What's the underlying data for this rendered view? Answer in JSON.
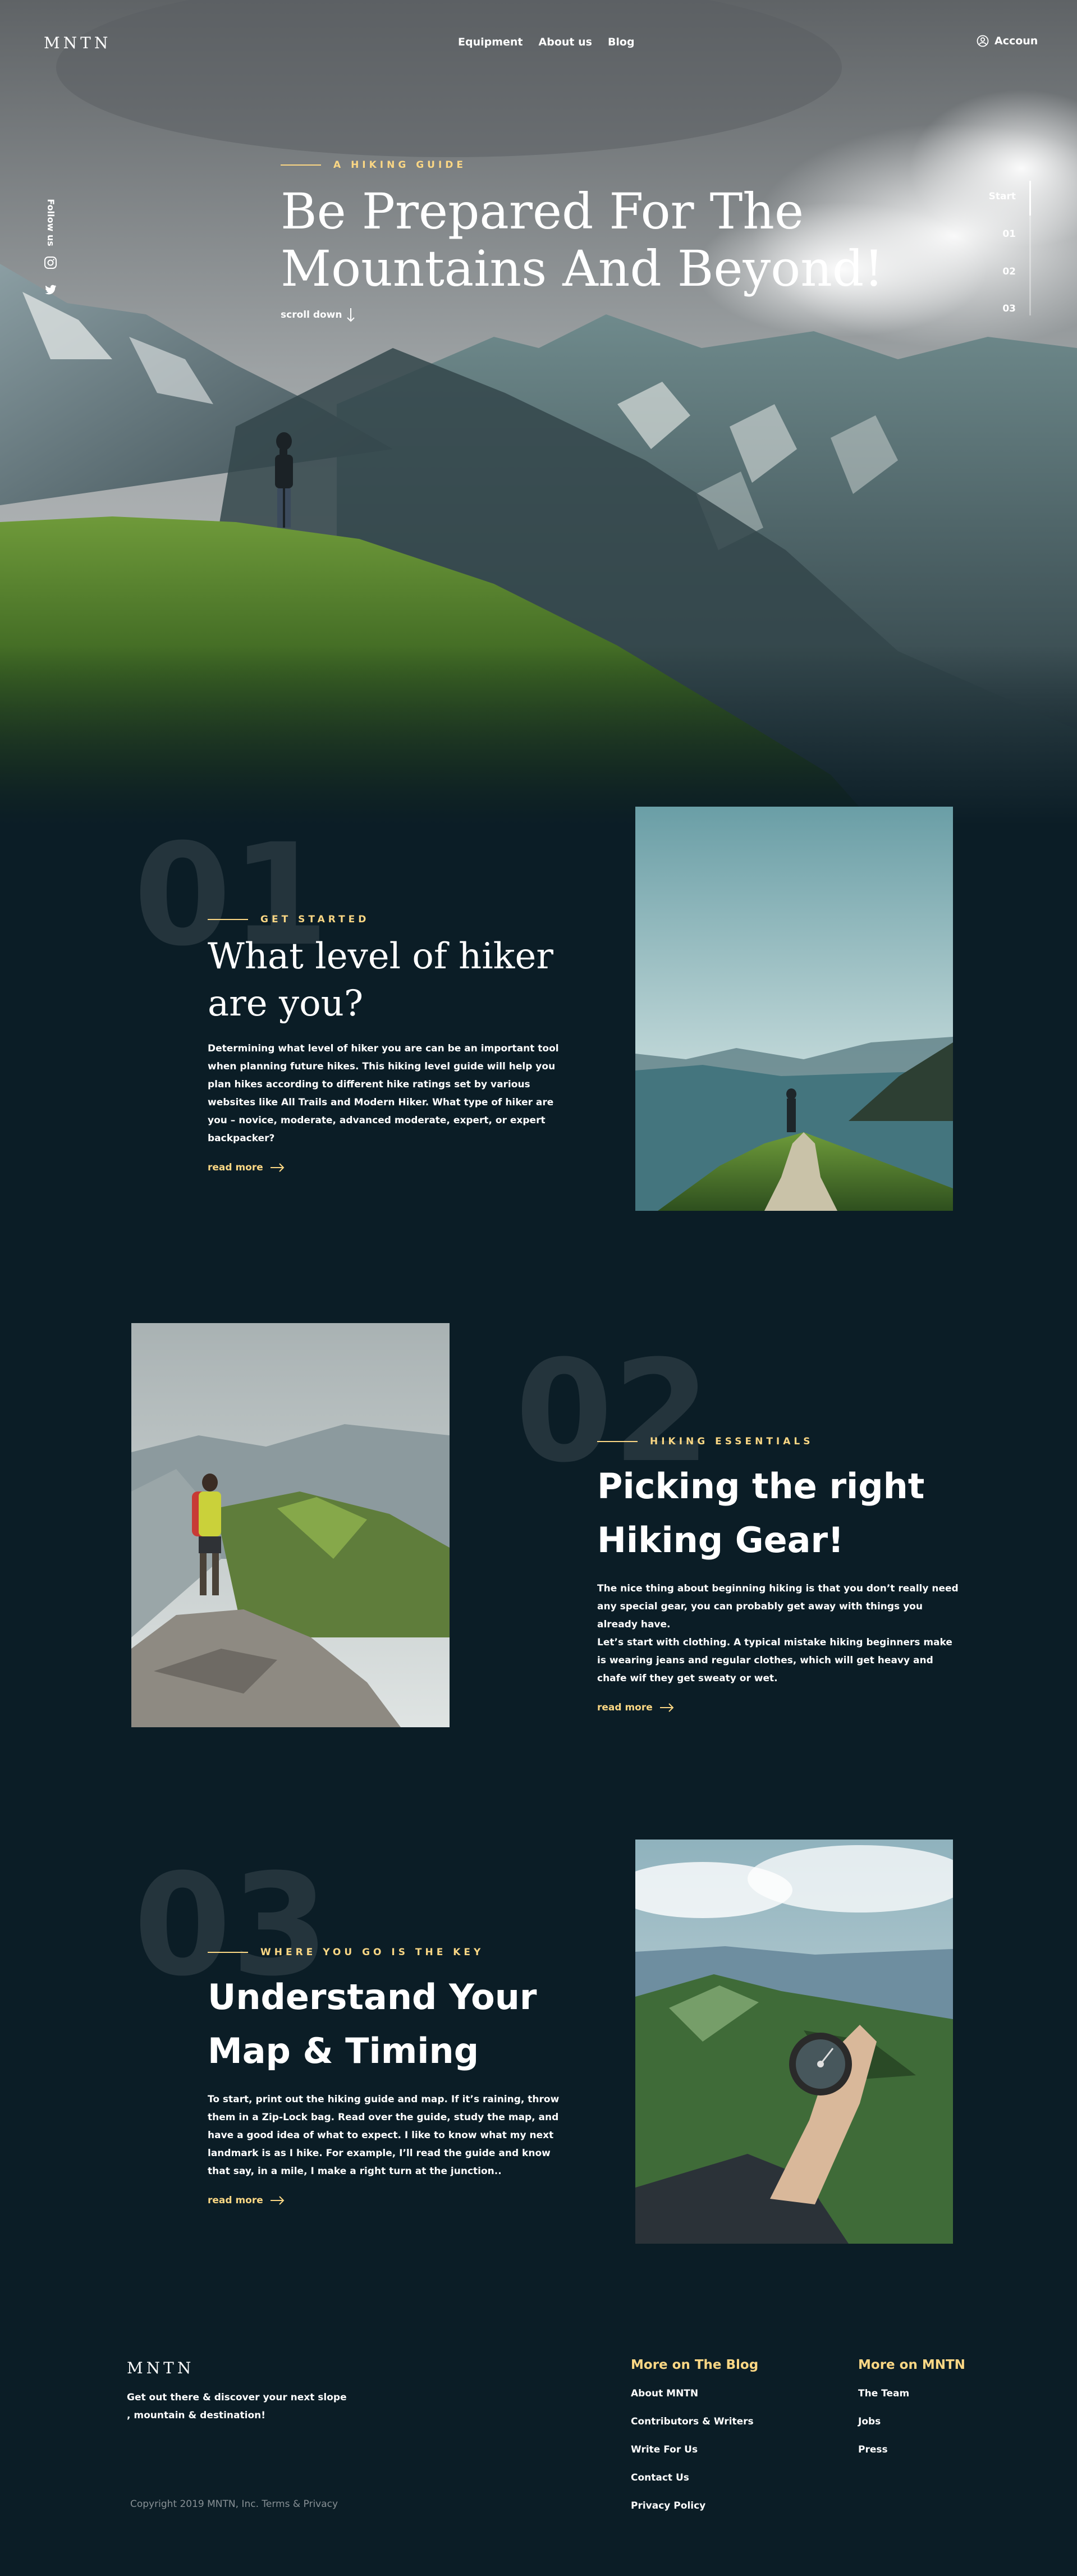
{
  "header": {
    "logo": "MNTN",
    "nav": [
      "Equipment",
      "About us",
      "Blog"
    ],
    "account": "Accoun"
  },
  "social": {
    "label": "Follow us",
    "icons": [
      "instagram-icon",
      "twitter-icon"
    ]
  },
  "hero": {
    "eyebrow": "A HIKING GUIDE",
    "title_line1": "Be Prepared For The",
    "title_line2": "Mountains And Beyond!",
    "scroll": "scroll down"
  },
  "progress": {
    "items": [
      "Start",
      "01",
      "02",
      "03"
    ],
    "active": "Start"
  },
  "sections": [
    {
      "number": "01",
      "eyebrow": "GET STARTED",
      "title_line1": "What level of  hiker",
      "title_line2": "are you?",
      "body": "Determining what level of hiker you are can be an important tool when planning future hikes. This hiking level guide will help you plan hikes according to different hike ratings set by various websites like All Trails and Modern Hiker. What type of hiker are you – novice, moderate, advanced moderate, expert, or expert backpacker?",
      "link": "read more"
    },
    {
      "number": "02",
      "eyebrow": "HIKING ESSENTIALS",
      "title_line1": "Picking the right",
      "title_line2": "Hiking Gear!",
      "body": "The nice thing about beginning hiking is that you don’t really need any special gear, you can probably get away with things you already have.",
      "body2": "Let’s start with clothing. A typical mistake hiking beginners make is wearing jeans and regular clothes, which will get heavy and chafe wif they get sweaty or wet.",
      "link": "read more"
    },
    {
      "number": "03",
      "eyebrow": "WHERE YOU GO IS THE KEY",
      "title_line1": "Understand Your",
      "title_line2": "Map & Timing",
      "body": "To start, print out the hiking guide and map. If it’s raining, throw them in a Zip-Lock bag. Read over the guide, study the map, and have a good idea of what to expect. I like to know what my next landmark is as I hike. For example, I’ll read the guide and know that say, in a mile, I make a right turn at the junction..",
      "link": "read more"
    }
  ],
  "footer": {
    "logo": "MNTN",
    "tagline_line1": "Get out there & discover your next slope",
    "tagline_line2": ", mountain & destination!",
    "copyright": "Copyright 2019 MNTN, Inc. Terms & Privacy",
    "blog_title": "More on The Blog",
    "blog_links": [
      "About MNTN",
      "Contributors & Writers",
      "Write For Us",
      "Contact Us",
      "Privacy Policy"
    ],
    "mntn_title": "More on MNTN",
    "mntn_links": [
      "The Team",
      "Jobs",
      "Press"
    ]
  },
  "colors": {
    "background": "#0b1d26",
    "accent": "#fbd784"
  }
}
